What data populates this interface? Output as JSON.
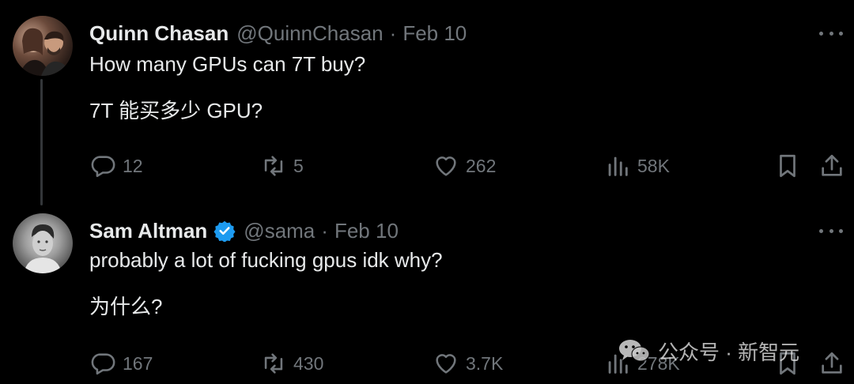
{
  "tweets": [
    {
      "name": "Quinn Chasan",
      "handle": "@QuinnChasan",
      "separator": "·",
      "date": "Feb 10",
      "verified": false,
      "lines": [
        "How many GPUs can 7T buy?",
        "7T 能买多少 GPU?"
      ],
      "replies": "12",
      "retweets": "5",
      "likes": "262",
      "views": "58K",
      "avatar_icon": "couple-photo-avatar"
    },
    {
      "name": "Sam Altman",
      "handle": "@sama",
      "separator": "·",
      "date": "Feb 10",
      "verified": true,
      "lines": [
        "probably a lot of fucking gpus idk why?",
        "为什么?"
      ],
      "replies": "167",
      "retweets": "430",
      "likes": "3.7K",
      "views": "278K",
      "avatar_icon": "portrait-photo-avatar"
    }
  ],
  "watermark": {
    "text": "公众号 · 新智元",
    "icon": "wechat-icon"
  },
  "colors": {
    "background": "#000000",
    "text": "#e7e9ea",
    "muted": "#71767b",
    "verified": "#1d9bf0",
    "thread_line": "#333639"
  }
}
